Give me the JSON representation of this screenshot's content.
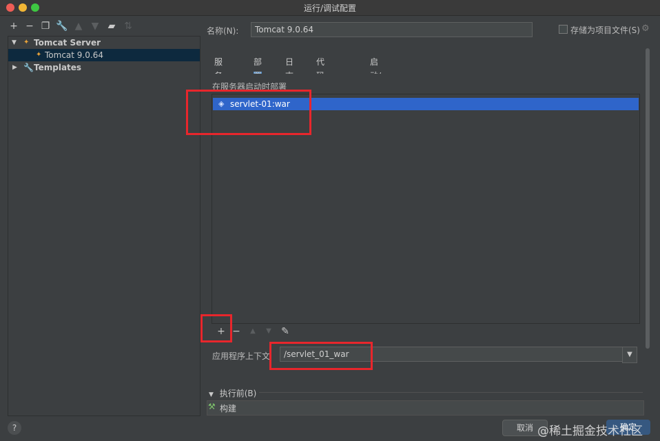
{
  "window": {
    "title": "运行/调试配置"
  },
  "left": {
    "tree": [
      {
        "label": "Tomcat Server"
      },
      {
        "label": "Tomcat 9.0.64"
      },
      {
        "label": "Templates"
      }
    ]
  },
  "form": {
    "name_label": "名称(N):",
    "name_value": "Tomcat 9.0.64",
    "store_label": "存储为项目文件(S)"
  },
  "tabs": [
    {
      "label": "服务器"
    },
    {
      "label": "部署"
    },
    {
      "label": "日志"
    },
    {
      "label": "代码覆盖率"
    },
    {
      "label": "启动/连接"
    }
  ],
  "deploy": {
    "section_label": "在服务器启动时部署",
    "artifacts": [
      {
        "label": "servlet-01:war"
      }
    ],
    "context_label": "应用程序上下文",
    "context_value": "/servlet_01_war"
  },
  "before_launch": {
    "label": "执行前(B)",
    "tasks": [
      {
        "label": "构建"
      }
    ]
  },
  "buttons": {
    "help": "?",
    "cancel": "取消",
    "ok": "确定"
  },
  "watermark": "@稀土掘金技术社区",
  "colors": {
    "accent": "#2f65ca",
    "annotation": "#e8262c",
    "background": "#3c3f41"
  }
}
